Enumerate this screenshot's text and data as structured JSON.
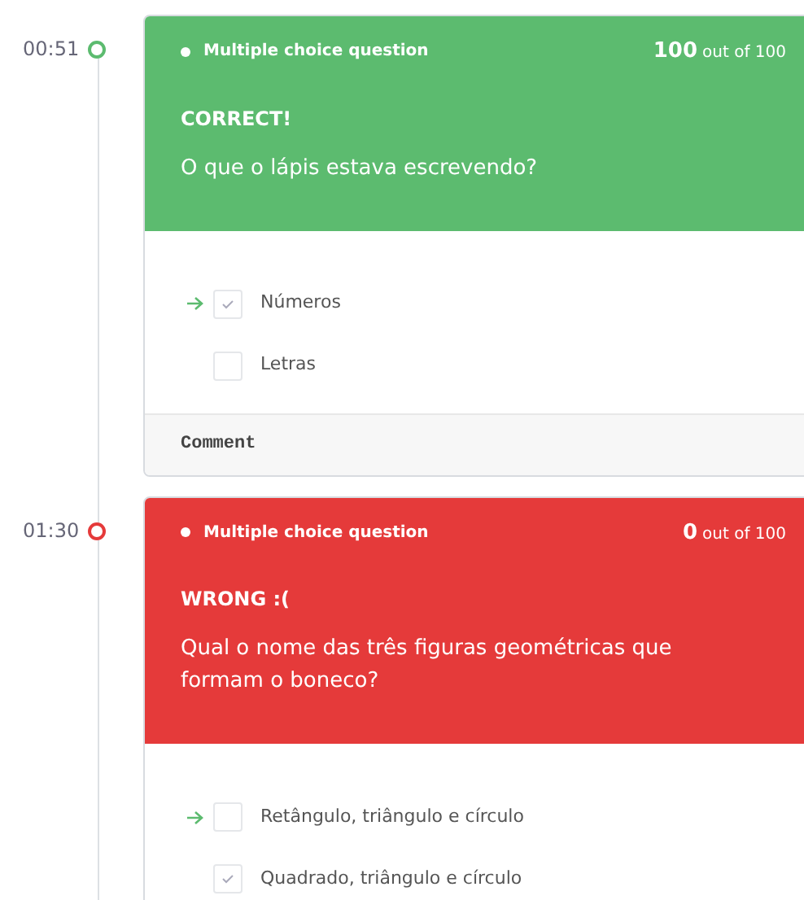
{
  "questions": [
    {
      "time": "00:51",
      "kind": "correct",
      "type_label": "Multiple choice question",
      "score": "100",
      "score_suffix": "out of 100",
      "verdict": "CORRECT!",
      "question": "O que o lápis estava escrevendo?",
      "options": [
        {
          "label": "Números",
          "correct": true,
          "checked": true
        },
        {
          "label": "Letras",
          "correct": false,
          "checked": false
        }
      ],
      "comment": "Comment"
    },
    {
      "time": "01:30",
      "kind": "wrong",
      "type_label": "Multiple choice question",
      "score": "0",
      "score_suffix": "out of 100",
      "verdict": "WRONG :(",
      "question": "Qual o nome das três figuras geométricas que formam o boneco?",
      "options": [
        {
          "label": "Retângulo, triângulo e círculo",
          "correct": true,
          "checked": false
        },
        {
          "label": "Quadrado, triângulo e círculo",
          "correct": false,
          "checked": true
        }
      ]
    }
  ]
}
